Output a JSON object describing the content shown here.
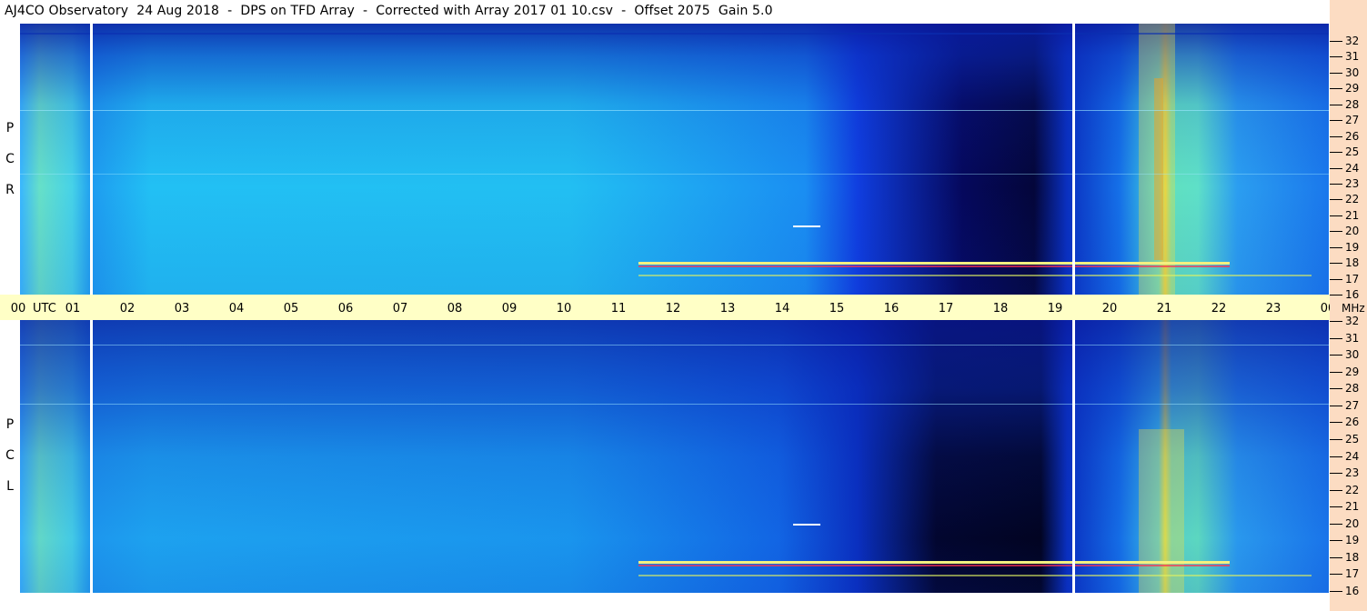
{
  "title": "AJ4CO Observatory  24 Aug 2018  -  DPS on TFD Array  -  Corrected with Array 2017 01 10.csv  -  Offset 2075  Gain 5.0",
  "chart_data": {
    "type": "heatmap",
    "title": "AJ4CO Observatory  24 Aug 2018  -  DPS on TFD Array  -  Corrected with Array 2017 01 10.csv  -  Offset 2075  Gain 5.0",
    "x_axis": {
      "label": "UTC",
      "ticks": [
        "00",
        "01",
        "02",
        "03",
        "04",
        "05",
        "06",
        "07",
        "08",
        "09",
        "10",
        "11",
        "12",
        "13",
        "14",
        "15",
        "16",
        "17",
        "18",
        "19",
        "20",
        "21",
        "22",
        "23",
        "00"
      ],
      "range_hours": [
        0,
        24
      ]
    },
    "y_axis": {
      "unit": "MHz",
      "ticks": [
        "32",
        "31",
        "30",
        "29",
        "28",
        "27",
        "26",
        "25",
        "24",
        "23",
        "22",
        "21",
        "20",
        "19",
        "18",
        "17",
        "16"
      ],
      "range_mhz": [
        16,
        32
      ]
    },
    "panels": [
      {
        "name": "RCP",
        "letters": [
          "R",
          "C",
          "P"
        ]
      },
      {
        "name": "LCP",
        "letters": [
          "L",
          "C",
          "P"
        ]
      }
    ],
    "colors": {
      "axis_time_bg": "#ffffc6",
      "axis_freq_bg": "#fcdcc2"
    }
  }
}
